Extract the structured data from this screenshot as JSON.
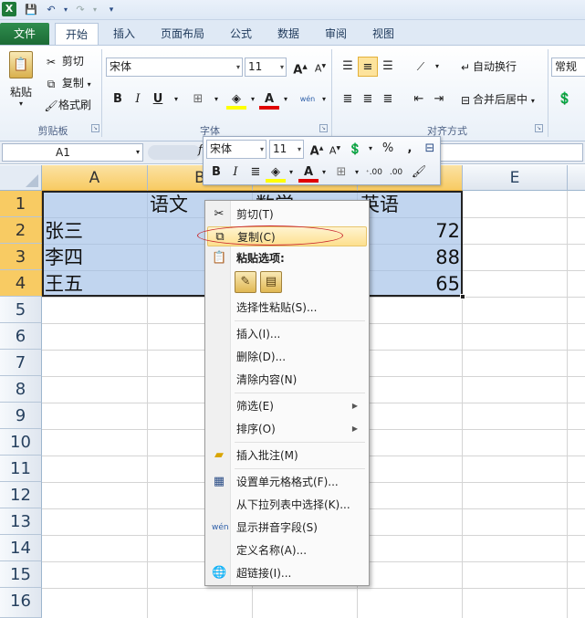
{
  "tabs": [
    "文件",
    "开始",
    "插入",
    "页面布局",
    "公式",
    "数据",
    "审阅",
    "视图"
  ],
  "clipboard": {
    "paste": "粘贴",
    "cut": "剪切",
    "copy": "复制",
    "format_painter": "格式刷",
    "group_label": "剪贴板"
  },
  "font": {
    "name": "宋体",
    "size": "11",
    "grow": "A",
    "shrink": "A",
    "bold": "B",
    "italic": "I",
    "underline": "U",
    "group_label": "字体",
    "phonetic": "wén",
    "color_letter": "A"
  },
  "alignment": {
    "wrap_text": "自动换行",
    "merge_center": "合并后居中",
    "group_label": "对齐方式"
  },
  "number": {
    "format": "常规"
  },
  "name_box": "A1",
  "formula_fx": "f",
  "mini_toolbar": {
    "font": "宋体",
    "size": "11",
    "percent": "%",
    "comma": ",",
    "inc_decimal": ".00",
    "dec_decimal": ".00"
  },
  "columns": [
    "A",
    "B",
    "C",
    "D",
    "E"
  ],
  "rows": [
    "1",
    "2",
    "3",
    "4",
    "5",
    "6",
    "7",
    "8",
    "9",
    "10",
    "11",
    "12",
    "13",
    "14",
    "15",
    "16"
  ],
  "cells": {
    "B1": "语文",
    "C1": "数学",
    "D1": "英语",
    "A2": "张三",
    "A3": "李四",
    "A4": "王五",
    "D2": "72",
    "D3": "88",
    "D4": "65"
  },
  "context_menu": {
    "cut": "剪切(T)",
    "copy": "复制(C)",
    "paste_options": "粘贴选项:",
    "paste_special": "选择性粘贴(S)...",
    "insert": "插入(I)...",
    "delete": "删除(D)...",
    "clear_contents": "清除内容(N)",
    "filter": "筛选(E)",
    "sort": "排序(O)",
    "insert_comment": "插入批注(M)",
    "format_cells": "设置单元格格式(F)...",
    "pick_from_list": "从下拉列表中选择(K)...",
    "show_phonetic": "显示拼音字段(S)",
    "define_name": "定义名称(A)...",
    "hyperlink": "超链接(I)..."
  },
  "colors": {
    "accent_file": "#1f7a3a",
    "selection": "#a0bee6",
    "highlight": "#f8cb63",
    "annotation": "#c8252c"
  }
}
